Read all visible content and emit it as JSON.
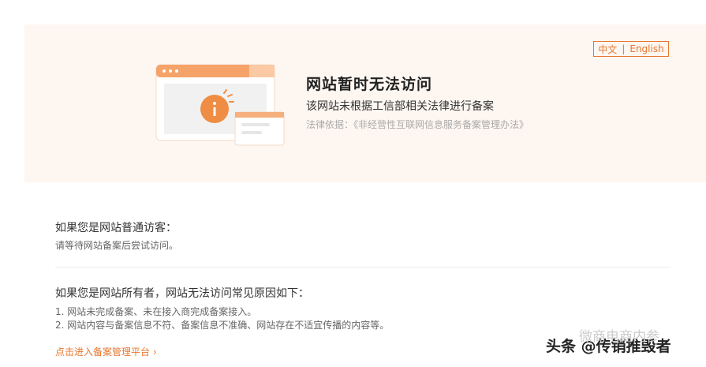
{
  "lang": {
    "zh": "中文",
    "sep": "|",
    "en": "English"
  },
  "notice": {
    "title": "网站暂时无法访问",
    "subtitle": "该网站未根据工信部相关法律进行备案",
    "law": "法律依据：《非经营性互联网信息服务备案管理办法》"
  },
  "visitor": {
    "heading": "如果您是网站普通访客：",
    "text": "请等待网站备案后尝试访问。"
  },
  "owner": {
    "heading": "如果您是网站所有者，网站无法访问常见原因如下：",
    "reasons": [
      "1. 网站未完成备案、未在接入商完成备案接入。",
      "2. 网站内容与备案信息不符、备案信息不准确、网站存在不适宜传播的内容等。"
    ]
  },
  "link": "点击进入备案管理平台 ›",
  "watermark": {
    "ghost": "微商电商内参",
    "main": "头条 @传销推毁者"
  },
  "colors": {
    "accent": "#e8772e",
    "banner_bg": "#fdf6f1"
  }
}
